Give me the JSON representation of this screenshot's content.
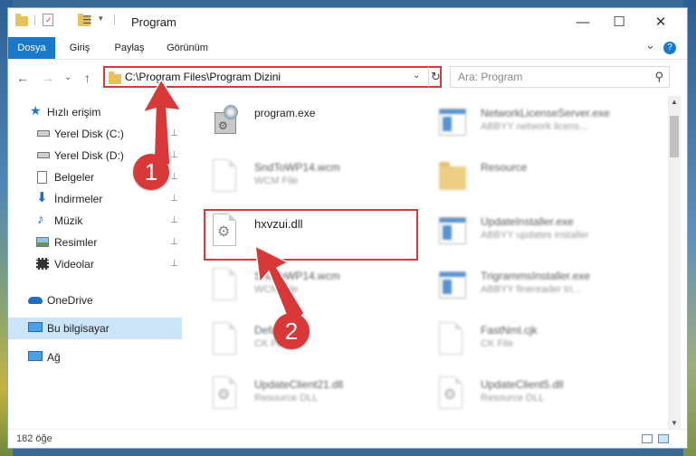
{
  "window": {
    "title": "Program",
    "minimize_glyph": "—",
    "maximize_glyph": "☐",
    "close_glyph": "✕"
  },
  "ribbon": {
    "tabs": [
      {
        "label": "Dosya",
        "active": true
      },
      {
        "label": "Giriş"
      },
      {
        "label": "Paylaş"
      },
      {
        "label": "Görünüm"
      }
    ],
    "expand_glyph": "⌄",
    "help_glyph": "?"
  },
  "nav": {
    "back_glyph": "←",
    "forward_glyph": "→",
    "recent_glyph": "⌄",
    "up_glyph": "↑"
  },
  "address": {
    "path": "C:\\Program Files\\Program Dizini",
    "dropdown_glyph": "⌄",
    "refresh_glyph": "↻"
  },
  "search": {
    "placeholder": "Ara: Program",
    "icon_glyph": "⚲"
  },
  "sidebar": {
    "items": [
      {
        "label": "Hızlı erişim",
        "icon": "star-icon",
        "pinned": false
      },
      {
        "label": "Yerel Disk (C:)",
        "icon": "drive-icon",
        "pinned": true
      },
      {
        "label": "Yerel Disk (D:)",
        "icon": "drive-icon",
        "pinned": true
      },
      {
        "label": "Belgeler",
        "icon": "documents-icon",
        "pinned": true
      },
      {
        "label": "İndirmeler",
        "icon": "download-icon",
        "pinned": true
      },
      {
        "label": "Müzik",
        "icon": "music-icon",
        "pinned": true
      },
      {
        "label": "Resimler",
        "icon": "pictures-icon",
        "pinned": true
      },
      {
        "label": "Videolar",
        "icon": "video-icon",
        "pinned": true
      },
      {
        "label": "OneDrive",
        "icon": "cloud-icon",
        "pinned": false
      },
      {
        "label": "Bu bilgisayar",
        "icon": "computer-icon",
        "pinned": false,
        "selected": true
      },
      {
        "label": "Ağ",
        "icon": "network-icon",
        "pinned": false
      }
    ],
    "pin_glyph": "📌"
  },
  "files": [
    {
      "name": "program.exe",
      "desc": "",
      "icon": "program-icon"
    },
    {
      "name": "NetworkLicenseServer.exe",
      "desc": "ABBYY network licens...",
      "icon": "exe-icon"
    },
    {
      "name": "SndToWP14.wcm",
      "desc": "WCM File",
      "icon": "document-icon"
    },
    {
      "name": "Resource",
      "desc": "",
      "icon": "folder-icon"
    },
    {
      "name": "hxvzui.dll",
      "desc": "",
      "icon": "dll-icon"
    },
    {
      "name": "UpdateInstaller.exe",
      "desc": "ABBYY updates installer",
      "icon": "exe-icon"
    },
    {
      "name": "SndToWP14.wcm",
      "desc": "WCM File",
      "icon": "document-icon"
    },
    {
      "name": "TrigrammsInstaller.exe",
      "desc": "ABBYY finereader tri...",
      "icon": "exe-icon"
    },
    {
      "name": "Default.cjk",
      "desc": "CK File",
      "icon": "document-icon"
    },
    {
      "name": "FastNml.cjk",
      "desc": "CK File",
      "icon": "document-icon"
    },
    {
      "name": "UpdateClient21.dll",
      "desc": "Resource DLL",
      "icon": "dll-icon"
    },
    {
      "name": "UpdateClient5.dll",
      "desc": "Resource DLL",
      "icon": "dll-icon"
    }
  ],
  "status": {
    "item_count": "182 öğe"
  },
  "markers": [
    {
      "label": "1"
    },
    {
      "label": "2"
    }
  ],
  "colors": {
    "accent": "#1979ca",
    "highlight_red": "#d93838",
    "selected_bg": "#cce4f7"
  }
}
